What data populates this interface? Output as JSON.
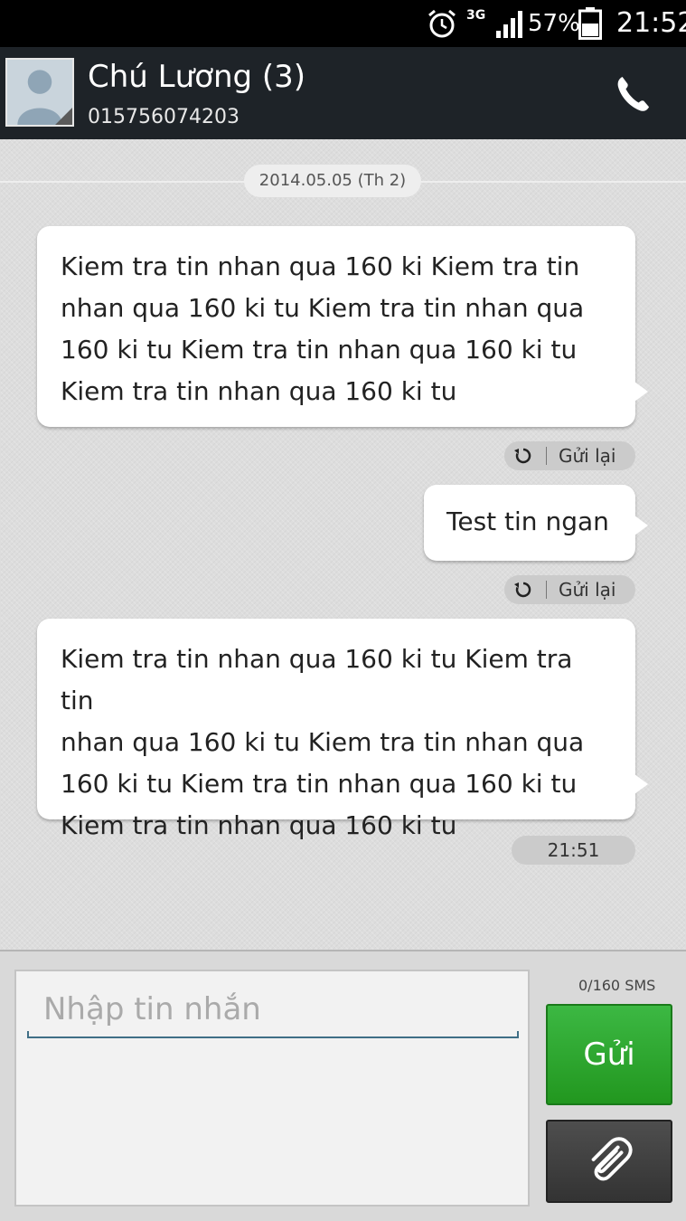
{
  "status_bar": {
    "network": "3G",
    "battery_percent": "57%",
    "time": "21:52",
    "icons": [
      "alarm-clock-icon",
      "signal-icon",
      "battery-icon"
    ]
  },
  "header": {
    "contact_name": "Chú Lương (3)",
    "phone_number": "015756074203",
    "call_icon": "phone-icon"
  },
  "conversation": {
    "date_separator": "2014.05.05 (Th 2)",
    "messages": [
      {
        "text_lines": [
          "Kiem tra tin nhan qua 160 ki Kiem tra tin",
          "nhan qua 160 ki tu Kiem tra tin nhan qua",
          "160 ki tu Kiem tra tin nhan qua 160 ki tu",
          "Kiem tra tin nhan qua 160 ki tu"
        ],
        "status": "Gửi lại"
      },
      {
        "text_lines": [
          "Test tin ngan"
        ],
        "status": "Gửi lại"
      },
      {
        "text_lines": [
          "Kiem tra tin nhan qua 160 ki tu Kiem tra tin",
          "nhan qua 160 ki tu Kiem tra tin nhan qua",
          "160 ki tu Kiem tra tin nhan qua 160 ki tu",
          "Kiem tra tin nhan qua 160 ki tu"
        ],
        "time": "21:51"
      }
    ]
  },
  "composer": {
    "placeholder": "Nhập tin nhắn",
    "counter": "0/160  SMS",
    "send_label": "Gửi",
    "attach_icon": "paperclip-icon"
  },
  "colors": {
    "header_bg": "#1e2328",
    "send_button": "#2fa82f",
    "attach_button": "#3f3f3f"
  }
}
